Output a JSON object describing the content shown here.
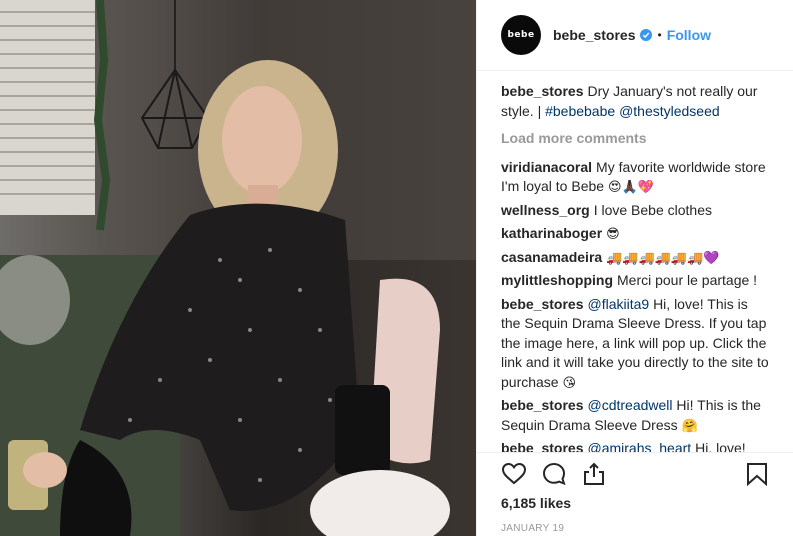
{
  "post": {
    "username": "bebe_stores",
    "avatar_text": "bebe",
    "verified_icon": "verified-badge-icon",
    "separator": "•",
    "follow_label": "Follow",
    "caption": {
      "user": "bebe_stores",
      "text": "Dry January's not really our style. |",
      "hashtag": "#bebebabe",
      "mention": "@thestyledseed"
    },
    "load_more": "Load more comments",
    "comments": [
      {
        "user": "viridianacoral",
        "text": "My favorite worldwide store I'm loyal to Bebe",
        "emoji": "😍🙏🏿💖"
      },
      {
        "user": "wellness_org",
        "text": "I love Bebe clothes",
        "emoji": ""
      },
      {
        "user": "katharinaboger",
        "text": "",
        "emoji": "😎"
      },
      {
        "user": "casanamadeira",
        "text": "",
        "emoji": "🚚🚚🚚🚚🚚🚚💜"
      },
      {
        "user": "mylittleshopping",
        "text": "Merci pour le partage !",
        "emoji": ""
      },
      {
        "user": "bebe_stores",
        "mention": "@flakiita9",
        "text": "Hi, love! This is the Sequin Drama Sleeve Dress. If you tap the image here, a link will pop up. Click the link and it will take you directly to the site to purchase",
        "emoji": "😘"
      },
      {
        "user": "bebe_stores",
        "mention": "@cdtreadwell",
        "text": "Hi! This is the Sequin Drama Sleeve Dress",
        "emoji": "🤗"
      },
      {
        "user": "bebe_stores",
        "mention": "@amirahs_heart",
        "text": "Hi, love!",
        "emoji": ""
      }
    ],
    "likes": "6,185 likes",
    "date": "JANUARY 19",
    "icons": [
      "heart-icon",
      "comment-icon",
      "share-icon",
      "bookmark-icon"
    ],
    "colors": {
      "link": "#3897f0",
      "mention": "#003569",
      "muted": "#999999",
      "text": "#262626"
    }
  }
}
